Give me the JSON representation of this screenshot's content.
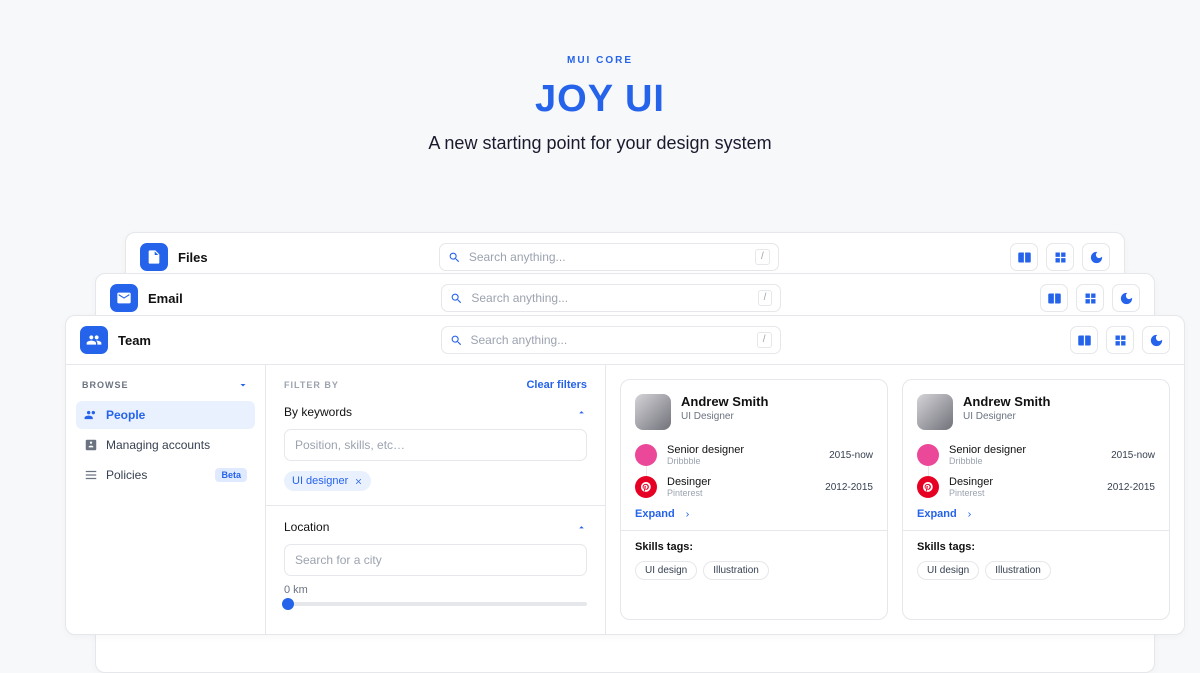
{
  "hero": {
    "kicker": "MUI CORE",
    "title": "JOY UI",
    "subtitle": "A new starting point for your design system"
  },
  "windows": {
    "files": {
      "title": "Files",
      "search_ph": "Search anything...",
      "kbd": "/"
    },
    "email": {
      "title": "Email",
      "search_ph": "Search anything...",
      "kbd": "/"
    },
    "team": {
      "title": "Team",
      "search_ph": "Search anything...",
      "kbd": "/"
    }
  },
  "sidebar": {
    "heading": "BROWSE",
    "items": [
      {
        "label": "People",
        "active": true
      },
      {
        "label": "Managing accounts"
      },
      {
        "label": "Policies",
        "badge": "Beta"
      }
    ]
  },
  "filters": {
    "heading": "FILTER BY",
    "clear": "Clear filters",
    "keywords": {
      "label": "By keywords",
      "placeholder": "Position, skills, etc…",
      "chip": "UI designer"
    },
    "location": {
      "label": "Location",
      "placeholder": "Search for a city",
      "slider_label": "0 km"
    }
  },
  "cards": [
    {
      "name": "Andrew Smith",
      "role": "UI Designer",
      "experience": [
        {
          "title": "Senior designer",
          "company": "Dribbble",
          "dates": "2015-now",
          "color": "pink"
        },
        {
          "title": "Desinger",
          "company": "Pinterest",
          "dates": "2012-2015",
          "color": "red"
        }
      ],
      "expand": "Expand",
      "skills_label": "Skills tags:",
      "tags": [
        "UI design",
        "Illustration"
      ]
    },
    {
      "name": "Andrew Smith",
      "role": "UI Designer",
      "experience": [
        {
          "title": "Senior designer",
          "company": "Dribbble",
          "dates": "2015-now",
          "color": "pink"
        },
        {
          "title": "Desinger",
          "company": "Pinterest",
          "dates": "2012-2015",
          "color": "red"
        }
      ],
      "expand": "Expand",
      "skills_label": "Skills tags:",
      "tags": [
        "UI design",
        "Illustration"
      ]
    }
  ]
}
